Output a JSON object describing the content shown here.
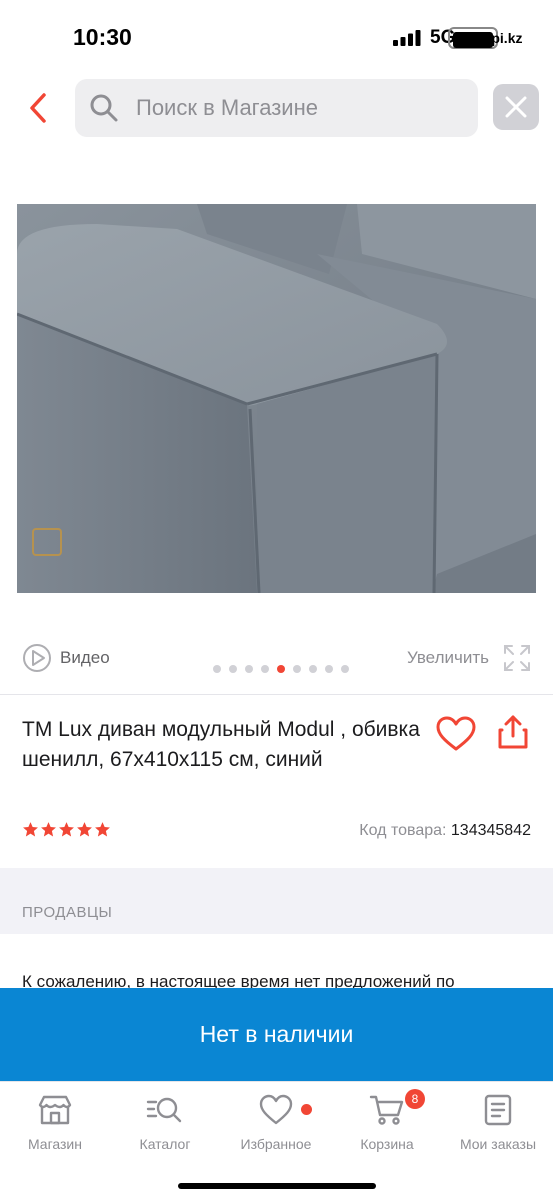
{
  "status_bar": {
    "time": "10:30",
    "network": "5G",
    "site": "kaspi.kz"
  },
  "search": {
    "placeholder": "Поиск в Магазине"
  },
  "gallery": {
    "video_label": "Видео",
    "zoom_label": "Увеличить",
    "dot_count": 9,
    "active_index": 4
  },
  "product": {
    "title": "TM Lux диван модульный Modul , обивка шенилл, 67x410x115 см, синий",
    "rating": 5,
    "code_label": "Код товара:",
    "code_value": "134345842"
  },
  "sellers": {
    "title": "ПРОДАВЦЫ",
    "message": "К сожалению, в настоящее время нет предложений по"
  },
  "stock_button": {
    "label": "Нет в наличии"
  },
  "nav": {
    "items": [
      {
        "label": "Магазин",
        "icon": "store-icon"
      },
      {
        "label": "Каталог",
        "icon": "catalog-search-icon"
      },
      {
        "label": "Избранное",
        "icon": "heart-icon"
      },
      {
        "label": "Корзина",
        "icon": "cart-icon",
        "badge": "8"
      },
      {
        "label": "Мои заказы",
        "icon": "orders-icon"
      }
    ]
  },
  "colors": {
    "accent_red": "#f14635",
    "button_blue": "#0a86d3"
  }
}
